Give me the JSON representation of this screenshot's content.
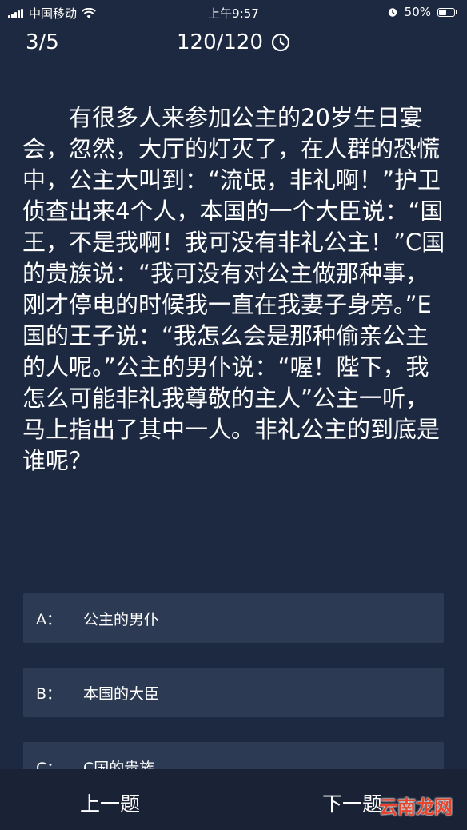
{
  "status": {
    "carrier": "中国移动",
    "time": "上午9:57",
    "battery_text": "50%",
    "battery_level": 0.5
  },
  "header": {
    "progress": "3/5",
    "timer": "120/120"
  },
  "question": {
    "text": "有很多人来参加公主的20岁生日宴会，忽然，大厅的灯灭了，在人群的恐慌中，公主大叫到：“流氓，非礼啊！”护卫侦查出来4个人，本国的一个大臣说：“国王，不是我啊！我可没有非礼公主！”C国的贵族说：“我可没有对公主做那种事，刚才停电的时候我一直在我妻子身旁。”E国的王子说：“我怎么会是那种偷亲公主的人呢。”公主的男仆说：“喔！陛下，我怎么可能非礼我尊敬的主人”公主一听，马上指出了其中一人。非礼公主的到底是谁呢？"
  },
  "options": [
    {
      "letter": "A：",
      "text": "公主的男仆"
    },
    {
      "letter": "B：",
      "text": "本国的大臣"
    },
    {
      "letter": "C：",
      "text": "C国的贵族"
    }
  ],
  "nav": {
    "prev_label": "上一题",
    "next_label": "下一题"
  },
  "watermark": "云南龙网"
}
